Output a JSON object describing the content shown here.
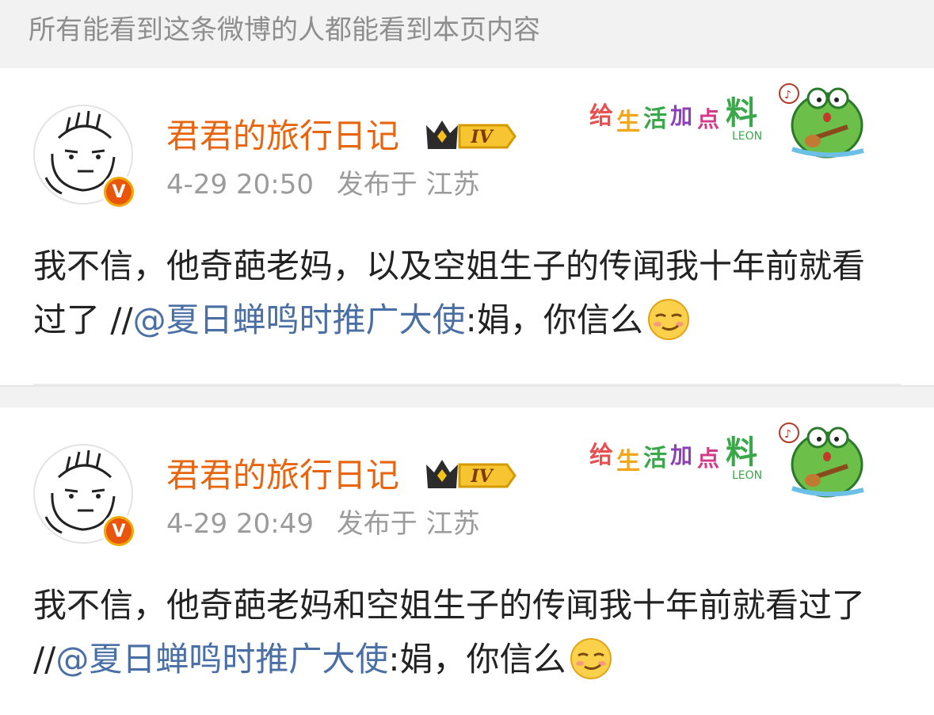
{
  "notice": "所有能看到这条微博的人都能看到本页内容",
  "colors": {
    "accent_name": "#e8650f",
    "mention": "#4a6fa5",
    "meta": "#9b9b9b"
  },
  "posts": [
    {
      "user_name": "君君的旅行日记",
      "level_badge": "IV",
      "time": "4-29 20:50",
      "location": "发布于 江苏",
      "decoration_text": "给生活加点料",
      "decoration_sub": "LEON",
      "text_before": "我不信，他奇葩老妈，以及空姐生子的传闻我十年前就看过了 //",
      "mention": "@夏日蝉鸣时推广大使",
      "text_after": ":娟，你信么",
      "emoji": "smirk-emoji"
    },
    {
      "user_name": "君君的旅行日记",
      "level_badge": "IV",
      "time": "4-29 20:49",
      "location": "发布于 江苏",
      "decoration_text": "给生活加点料",
      "decoration_sub": "LEON",
      "text_before": "我不信，他奇葩老妈和空姐生子的传闻我十年前就看过了 //",
      "mention": "@夏日蝉鸣时推广大使",
      "text_after": ":娟，你信么",
      "emoji": "smirk-emoji"
    }
  ]
}
